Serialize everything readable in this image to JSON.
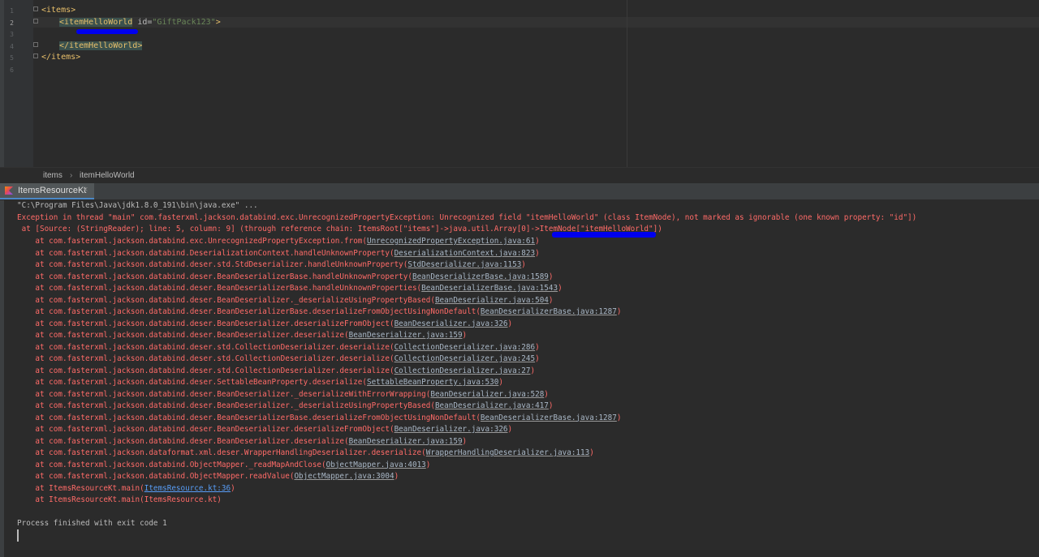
{
  "editor": {
    "line_numbers": [
      "1",
      "2",
      "3",
      "4",
      "5",
      "6"
    ],
    "lines": {
      "l1": {
        "tag": "<items>"
      },
      "l2": {
        "open": "<itemHelloWorld",
        "attr": " id=",
        "val": "\"GiftPack123\"",
        "close": ">"
      },
      "l4": {
        "tag": "</itemHelloWorld>"
      },
      "l5": {
        "tag": "</items>"
      }
    }
  },
  "breadcrumb": {
    "root": "items",
    "separator": "›",
    "child": "itemHelloWorld"
  },
  "run_tab": {
    "label": "ItemsResourceKt",
    "close": "×"
  },
  "console": {
    "command": "\"C:\\Program Files\\Java\\jdk1.8.0_191\\bin\\java.exe\" ...",
    "exception": "Exception in thread \"main\" com.fasterxml.jackson.databind.exc.UnrecognizedPropertyException: Unrecognized field \"itemHelloWorld\" (class ItemNode), not marked as ignorable (one known property: \"id\"])",
    "source_line": " at [Source: (StringReader); line: 5, column: 9] (through reference chain: ItemsRoot[\"items\"]->java.util.Array",
    "source_tail": "[0]->ItemNode[\"itemHelloWorld\"])",
    "stack": [
      {
        "prefix": "    at com.fasterxml.jackson.databind.exc.UnrecognizedPropertyException.from(",
        "link": "UnrecognizedPropertyException.java:61",
        "suffix": ")"
      },
      {
        "prefix": "    at com.fasterxml.jackson.databind.DeserializationContext.handleUnknownProperty(",
        "link": "DeserializationContext.java:823",
        "suffix": ")"
      },
      {
        "prefix": "    at com.fasterxml.jackson.databind.deser.std.StdDeserializer.handleUnknownProperty(",
        "link": "StdDeserializer.java:1153",
        "suffix": ")"
      },
      {
        "prefix": "    at com.fasterxml.jackson.databind.deser.BeanDeserializerBase.handleUnknownProperty(",
        "link": "BeanDeserializerBase.java:1589",
        "suffix": ")"
      },
      {
        "prefix": "    at com.fasterxml.jackson.databind.deser.BeanDeserializerBase.handleUnknownProperties(",
        "link": "BeanDeserializerBase.java:1543",
        "suffix": ")"
      },
      {
        "prefix": "    at com.fasterxml.jackson.databind.deser.BeanDeserializer._deserializeUsingPropertyBased(",
        "link": "BeanDeserializer.java:504",
        "suffix": ")"
      },
      {
        "prefix": "    at com.fasterxml.jackson.databind.deser.BeanDeserializerBase.deserializeFromObjectUsingNonDefault(",
        "link": "BeanDeserializerBase.java:1287",
        "suffix": ")"
      },
      {
        "prefix": "    at com.fasterxml.jackson.databind.deser.BeanDeserializer.deserializeFromObject(",
        "link": "BeanDeserializer.java:326",
        "suffix": ")"
      },
      {
        "prefix": "    at com.fasterxml.jackson.databind.deser.BeanDeserializer.deserialize(",
        "link": "BeanDeserializer.java:159",
        "suffix": ")"
      },
      {
        "prefix": "    at com.fasterxml.jackson.databind.deser.std.CollectionDeserializer.deserialize(",
        "link": "CollectionDeserializer.java:286",
        "suffix": ")"
      },
      {
        "prefix": "    at com.fasterxml.jackson.databind.deser.std.CollectionDeserializer.deserialize(",
        "link": "CollectionDeserializer.java:245",
        "suffix": ")"
      },
      {
        "prefix": "    at com.fasterxml.jackson.databind.deser.std.CollectionDeserializer.deserialize(",
        "link": "CollectionDeserializer.java:27",
        "suffix": ")"
      },
      {
        "prefix": "    at com.fasterxml.jackson.databind.deser.SettableBeanProperty.deserialize(",
        "link": "SettableBeanProperty.java:530",
        "suffix": ")"
      },
      {
        "prefix": "    at com.fasterxml.jackson.databind.deser.BeanDeserializer._deserializeWithErrorWrapping(",
        "link": "BeanDeserializer.java:528",
        "suffix": ")"
      },
      {
        "prefix": "    at com.fasterxml.jackson.databind.deser.BeanDeserializer._deserializeUsingPropertyBased(",
        "link": "BeanDeserializer.java:417",
        "suffix": ")"
      },
      {
        "prefix": "    at com.fasterxml.jackson.databind.deser.BeanDeserializerBase.deserializeFromObjectUsingNonDefault(",
        "link": "BeanDeserializerBase.java:1287",
        "suffix": ")"
      },
      {
        "prefix": "    at com.fasterxml.jackson.databind.deser.BeanDeserializer.deserializeFromObject(",
        "link": "BeanDeserializer.java:326",
        "suffix": ")"
      },
      {
        "prefix": "    at com.fasterxml.jackson.databind.deser.BeanDeserializer.deserialize(",
        "link": "BeanDeserializer.java:159",
        "suffix": ")"
      },
      {
        "prefix": "    at com.fasterxml.jackson.dataformat.xml.deser.WrapperHandlingDeserializer.deserialize(",
        "link": "WrapperHandlingDeserializer.java:113",
        "suffix": ")"
      },
      {
        "prefix": "    at com.fasterxml.jackson.databind.ObjectMapper._readMapAndClose(",
        "link": "ObjectMapper.java:4013",
        "suffix": ")"
      },
      {
        "prefix": "    at com.fasterxml.jackson.databind.ObjectMapper.readValue(",
        "link": "ObjectMapper.java:3004",
        "suffix": ")"
      },
      {
        "prefix": "    at ItemsResourceKt.main(",
        "link": "ItemsResource.kt:36",
        "suffix": ")"
      },
      {
        "prefix": "    at ItemsResourceKt.main(ItemsResource.kt)",
        "link": "",
        "suffix": ""
      }
    ],
    "finish": "Process finished with exit code 1"
  }
}
